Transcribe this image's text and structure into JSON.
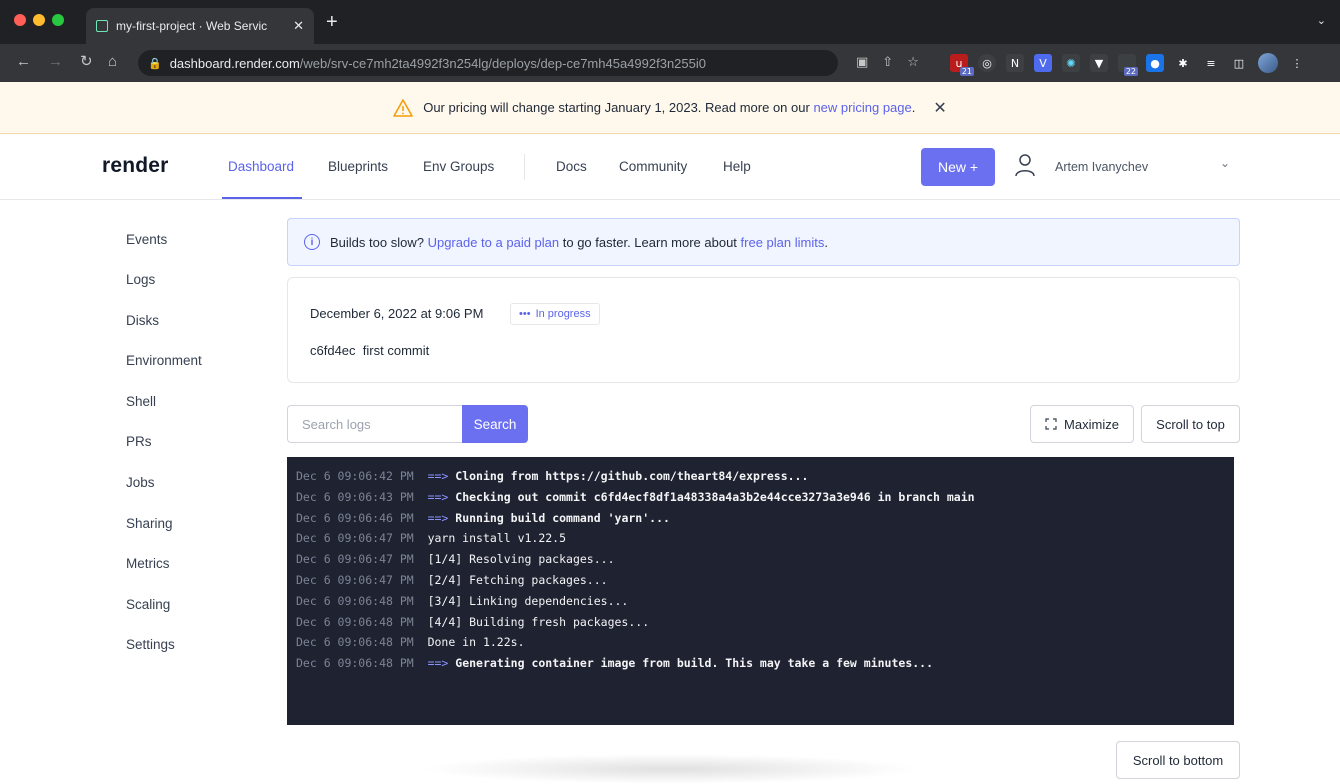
{
  "browser": {
    "tab_title": "my-first-project · Web Servic",
    "tab_close": "✕",
    "new_tab": "+",
    "url_host": "dashboard.render.com",
    "url_path": "/web/srv-ce7mh2ta4992f3n254lg/deploys/dep-ce7mh45a4992f3n255i0",
    "extension_badges": [
      "21",
      "22"
    ]
  },
  "banner": {
    "text": "Our pricing will change starting January 1, 2023. Read more on our",
    "link": "new pricing page",
    "suffix": ".",
    "close": "✕"
  },
  "topnav": {
    "logo": "render",
    "links": [
      "Dashboard",
      "Blueprints",
      "Env Groups",
      "Docs",
      "Community",
      "Help"
    ],
    "new_button": "New +",
    "user_name": "Artem Ivanychev"
  },
  "sidebar": {
    "items": [
      "Events",
      "Logs",
      "Disks",
      "Environment",
      "Shell",
      "PRs",
      "Jobs",
      "Sharing",
      "Metrics",
      "Scaling",
      "Settings"
    ]
  },
  "info": {
    "prefix": "Builds too slow?",
    "link1": "Upgrade to a paid plan",
    "middle": "to go faster. Learn more about",
    "link2": "free plan limits",
    "suffix": "."
  },
  "deploy": {
    "date": "December 6, 2022 at 9:06 PM",
    "status": "In progress",
    "commit_hash": "c6fd4ec",
    "commit_message": "first commit"
  },
  "logs_toolbar": {
    "search_placeholder": "Search logs",
    "search_button": "Search",
    "maximize": "Maximize",
    "scroll_top": "Scroll to top",
    "scroll_bottom": "Scroll to bottom"
  },
  "logs": [
    {
      "ts": "Dec 6 09:06:42 PM",
      "arrow": "==>",
      "msg": "Cloning from https://github.com/theart84/express...",
      "bold": true
    },
    {
      "ts": "Dec 6 09:06:43 PM",
      "arrow": "==>",
      "msg": "Checking out commit c6fd4ecf8df1a48338a4a3b2e44cce3273a3e946 in branch main",
      "bold": true
    },
    {
      "ts": "Dec 6 09:06:46 PM",
      "arrow": "==>",
      "msg": "Running build command 'yarn'...",
      "bold": true
    },
    {
      "ts": "Dec 6 09:06:47 PM",
      "arrow": "",
      "msg": "yarn install v1.22.5",
      "bold": false
    },
    {
      "ts": "Dec 6 09:06:47 PM",
      "arrow": "",
      "msg": "[1/4] Resolving packages...",
      "bold": false
    },
    {
      "ts": "Dec 6 09:06:47 PM",
      "arrow": "",
      "msg": "[2/4] Fetching packages...",
      "bold": false
    },
    {
      "ts": "Dec 6 09:06:48 PM",
      "arrow": "",
      "msg": "[3/4] Linking dependencies...",
      "bold": false
    },
    {
      "ts": "Dec 6 09:06:48 PM",
      "arrow": "",
      "msg": "[4/4] Building fresh packages...",
      "bold": false
    },
    {
      "ts": "Dec 6 09:06:48 PM",
      "arrow": "",
      "msg": "Done in 1.22s.",
      "bold": false
    },
    {
      "ts": "Dec 6 09:06:48 PM",
      "arrow": "==>",
      "msg": "Generating container image from build. This may take a few minutes...",
      "bold": true
    }
  ],
  "colors": {
    "accent": "#6a70f0",
    "link": "#5b63ea",
    "log_bg": "#1f2230",
    "banner_bg": "#fff8ec"
  }
}
